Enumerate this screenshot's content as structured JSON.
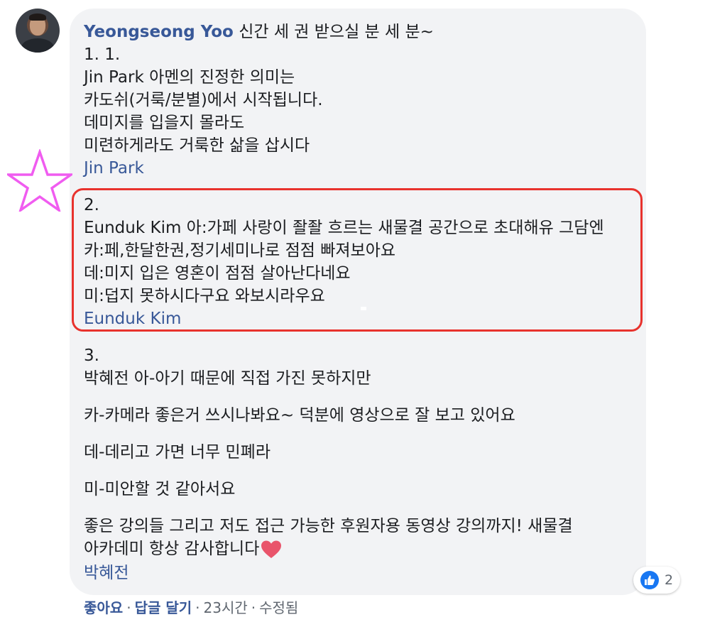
{
  "comment": {
    "author": "Yeongseong Yoo",
    "first_text": "신간 세 권 받으실 분 세 분~",
    "lines": [
      "1. 1.",
      "Jin Park 아멘의 진정한 의미는",
      "카도쉬(거룩/분별)에서 시작됩니다.",
      "데미지를 입을지 몰라도",
      "미련하게라도 거룩한 삶을 삽시다"
    ],
    "mention1": "Jin Park",
    "section2": [
      "2.",
      "Eunduk Kim 아:가페 사랑이 좔좔 흐르는 새물결 공간으로 초대해유 그담엔",
      "카:페,한달한권,정기세미나로 점점 빠져보아요",
      "데:미지 입은 영혼이 점점 살아난다네요",
      "미:덥지 못하시다구요 와보시라우요"
    ],
    "mention2": "Eunduk Kim",
    "section3": [
      "3.",
      "박혜전 아-아기 때문에 직접 가진 못하지만",
      "카-카메라 좋은거 쓰시나봐요~ 덕분에 영상으로 잘 보고 있어요",
      "데-데리고 가면 너무 민폐라",
      "미-미안할 것 같아서요",
      "좋은 강의들 그리고 저도 접근 가능한 후원자용 동영상 강의까지! 새물결",
      "아카데미 항상 감사합니다"
    ],
    "mention3": "박혜전"
  },
  "reactions": {
    "icon": "like-thumb-icon",
    "count": "2"
  },
  "footer": {
    "like": "좋아요",
    "reply": "답글 달기",
    "time": "23시간",
    "edited": "수정됨"
  },
  "colors": {
    "link": "#385898",
    "bubble": "#f2f3f5",
    "highlight_box": "#e8322d",
    "star": "#f05cf0",
    "heart": "#e9546b",
    "like_badge": "#1877f2"
  }
}
